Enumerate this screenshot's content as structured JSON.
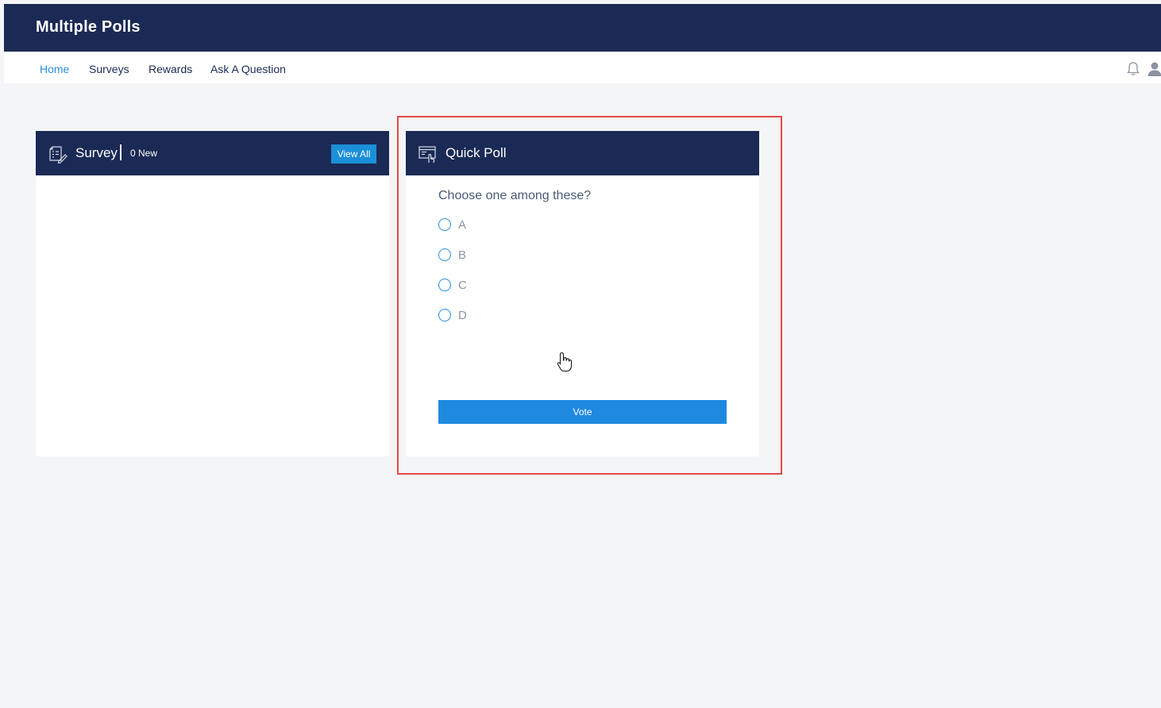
{
  "app": {
    "title": "Multiple Polls"
  },
  "nav": {
    "items": [
      {
        "label": "Home"
      },
      {
        "label": "Surveys"
      },
      {
        "label": "Rewards"
      },
      {
        "label": "Ask A Question"
      }
    ]
  },
  "survey_card": {
    "title": "Survey",
    "count_label": "0 New",
    "view_all_label": "View All"
  },
  "poll_card": {
    "title": "Quick Poll",
    "question": "Choose one among these?",
    "options": [
      {
        "label": "A"
      },
      {
        "label": "B"
      },
      {
        "label": "C"
      },
      {
        "label": "D"
      }
    ],
    "vote_label": "Vote"
  },
  "colors": {
    "header_navy": "#1b2a55",
    "accent_blue": "#2a8fd8",
    "vote_blue": "#1f89e0",
    "highlight_red": "#e34b4b",
    "page_bg": "#f4f5f7"
  }
}
